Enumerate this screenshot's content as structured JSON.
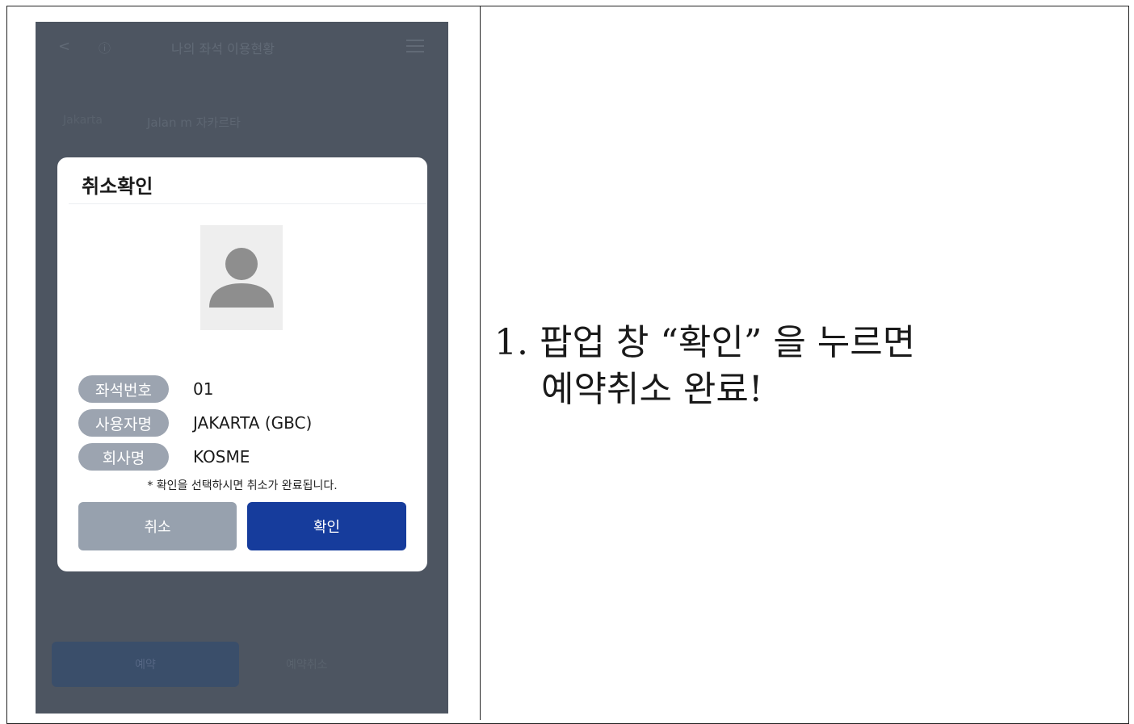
{
  "phone": {
    "header": {
      "back_icon": "<",
      "home_label": "ⓘ",
      "title": "나의 좌석 이용현황",
      "menu_icon": "hamburger-icon"
    },
    "sub_left": "Jakarta",
    "sub_title": "Jalan m 자카르타",
    "bottom_left_label": "예약",
    "bottom_right_label": "예약취소"
  },
  "dialog": {
    "title": "취소확인",
    "avatar_icon": "person-placeholder-icon",
    "rows": [
      {
        "label": "좌석번호",
        "value": "01"
      },
      {
        "label": "사용자명",
        "value": "JAKARTA (GBC)"
      },
      {
        "label": "회사명",
        "value": "KOSME"
      }
    ],
    "note": "* 확인을 선택하시면 취소가 완료됩니다.",
    "cancel_label": "취소",
    "confirm_label": "확인"
  },
  "instruction": {
    "line1": "1. 팝업 창 “확인” 을 누르면",
    "line2": "예약취소 완료!"
  },
  "colors": {
    "overlay": "#4d5561",
    "pill": "#9ca4b0",
    "cancel_button": "#97a1ae",
    "confirm_button": "#163c9c"
  }
}
